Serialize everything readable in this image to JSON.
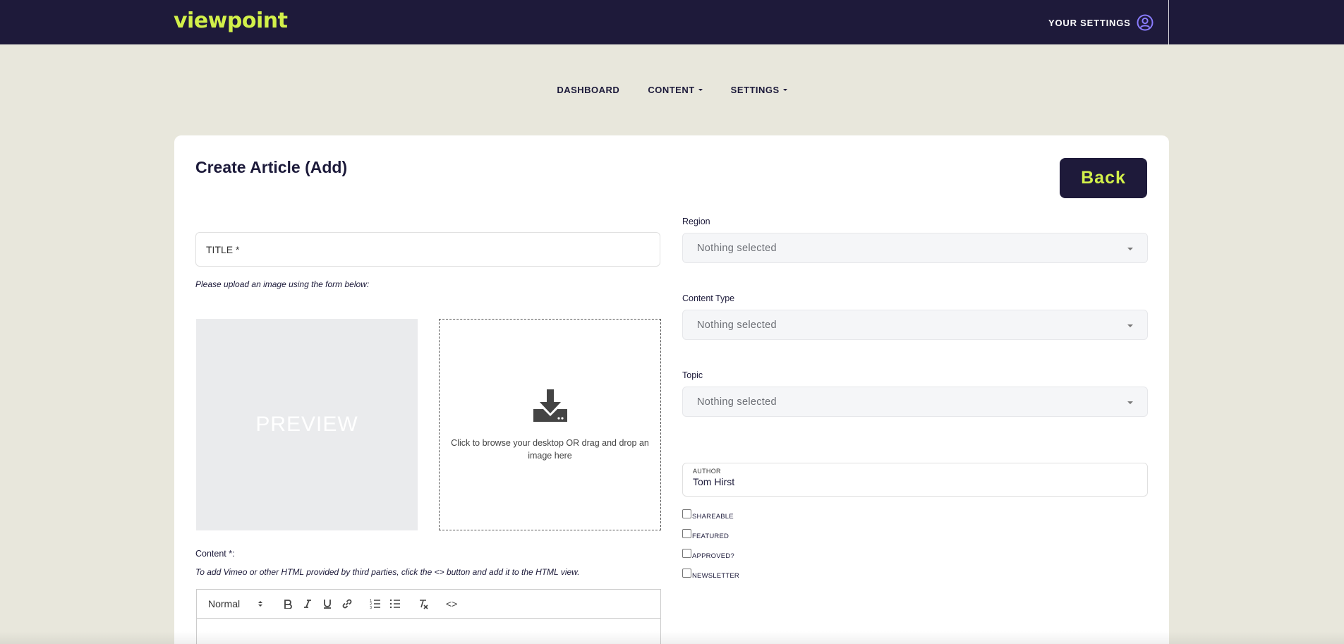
{
  "header": {
    "logo": "viewpoint",
    "settings_label": "YOUR SETTINGS",
    "brand_color": "#d2f04a",
    "bar_color": "#1e1a3a"
  },
  "nav": {
    "items": [
      {
        "label": "DASHBOARD",
        "dropdown": false
      },
      {
        "label": "CONTENT",
        "dropdown": true
      },
      {
        "label": "SETTINGS",
        "dropdown": true
      }
    ]
  },
  "form": {
    "title": "Create Article (Add)",
    "back_label": "Back",
    "title_field": "TITLE *",
    "upload_note": "Please upload an image using the form below:",
    "preview_label": "PREVIEW",
    "dropzone_text": "Click to browse your desktop OR drag and drop an image here",
    "content_label": "Content *:",
    "content_note": "To add Vimeo or other HTML provided by third parties, click the <> button and add it to the HTML view.",
    "editor": {
      "format_select": "Normal",
      "buttons": [
        "bold-icon",
        "italic-icon",
        "underline-icon",
        "link-icon",
        "ordered-list-icon",
        "bullet-list-icon",
        "clear-format-icon",
        "code-view-icon"
      ],
      "code_label": "<>"
    },
    "region": {
      "label": "Region",
      "value": "Nothing selected"
    },
    "content_type": {
      "label": "Content Type",
      "value": "Nothing selected"
    },
    "topic": {
      "label": "Topic",
      "value": "Nothing selected"
    },
    "author": {
      "label": "AUTHOR",
      "value": "Tom Hirst"
    },
    "checkboxes": [
      {
        "label": "SHAREABLE",
        "checked": false
      },
      {
        "label": "FEATURED",
        "checked": false
      },
      {
        "label": "APPROVED?",
        "checked": false
      },
      {
        "label": "NEWSLETTER",
        "checked": false
      }
    ]
  }
}
